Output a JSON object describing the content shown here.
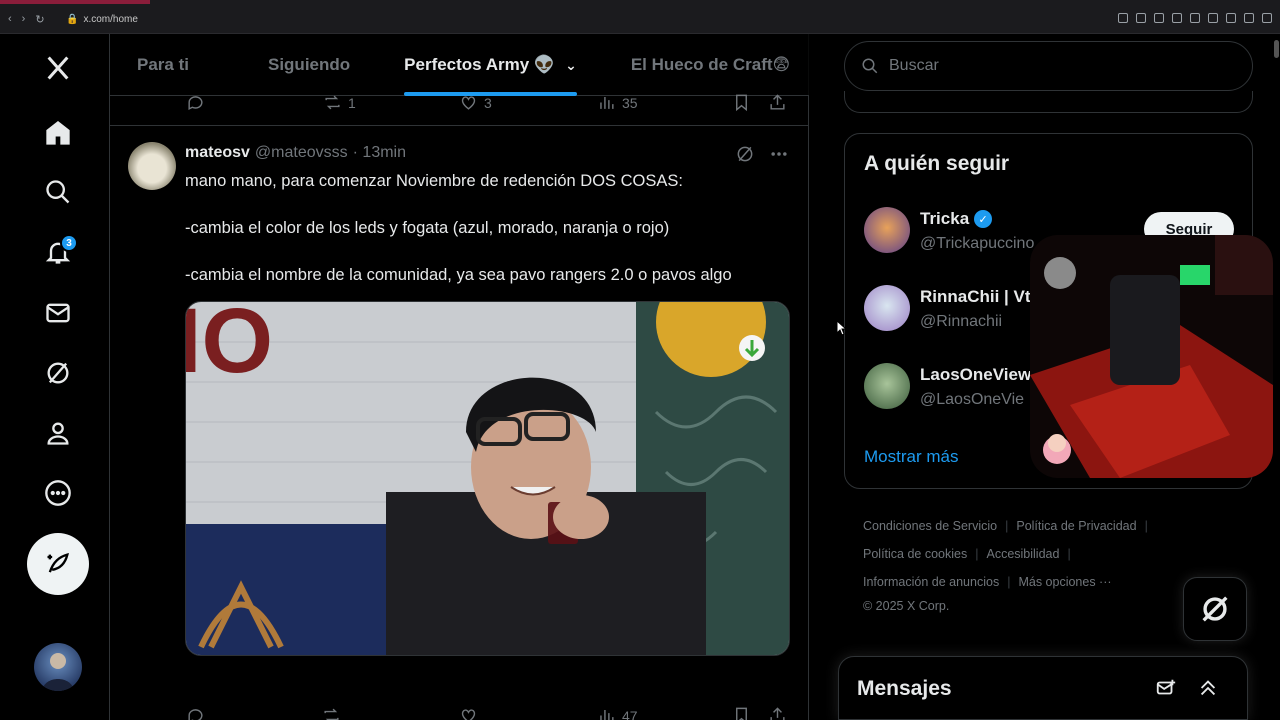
{
  "browser": {
    "url": "x.com/home"
  },
  "nav": {
    "items": [
      "home",
      "explore",
      "notifications",
      "messages",
      "grok",
      "profile",
      "more"
    ],
    "notifications_badge": "3"
  },
  "tabs": [
    {
      "label": "Para ti",
      "active": false
    },
    {
      "label": "Siguiendo",
      "active": false
    },
    {
      "label": "Perfectos Army 👽",
      "active": true
    },
    {
      "label": "El Hueco de Craft😨",
      "active": false
    }
  ],
  "prev_tweet": {
    "replies": "",
    "retweets": "1",
    "likes": "3",
    "views": "35"
  },
  "tweet": {
    "name": "mateosv",
    "handle": "@mateovsss",
    "time": "· 13min",
    "lines": [
      "mano mano, para comenzar Noviembre de redención DOS COSAS:",
      "-cambia el color de los leds y fogata  (azul, morado, naranja o rojo)",
      "-cambia el nombre de la comunidad, ya sea pavo rangers 2.0 o pavos algo"
    ],
    "media_text": "IO",
    "views": "47"
  },
  "search": {
    "placeholder": "Buscar"
  },
  "who_to_follow": {
    "title": "A quién seguir",
    "users": [
      {
        "name": "Tricka",
        "handle": "@Trickapuccino",
        "verified": true
      },
      {
        "name": "RinnaChii | Vt",
        "handle": "@Rinnachii",
        "verified": false
      },
      {
        "name": "LaosOneView",
        "handle": "@LaosOneVie",
        "verified": false
      }
    ],
    "follow_label": "Seguir",
    "show_more": "Mostrar más"
  },
  "footer": {
    "links": [
      "Condiciones de Servicio",
      "Política de Privacidad",
      "Política de cookies",
      "Accesibilidad",
      "Información de anuncios",
      "Más opciones ···"
    ],
    "copyright": "© 2025 X Corp."
  },
  "messages": {
    "title": "Mensajes"
  },
  "colors": {
    "accent": "#1d9bf0",
    "bg": "#000000",
    "muted": "#71767b"
  }
}
